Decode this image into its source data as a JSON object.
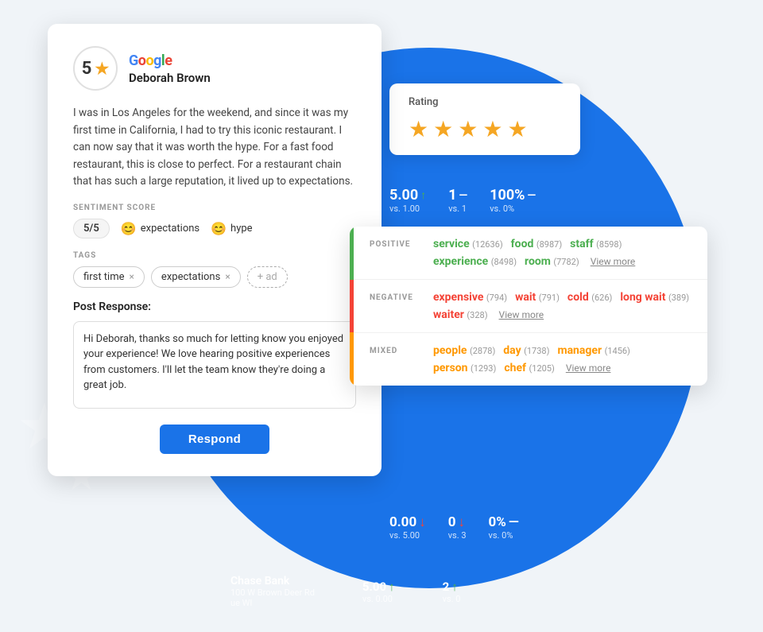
{
  "background": {
    "circle_color": "#1a73e8"
  },
  "review_card": {
    "rating": "5",
    "star_symbol": "★",
    "google_label": "Google",
    "reviewer_name": "Deborah Brown",
    "review_text": "I was in Los Angeles for the weekend, and since it was my first time in California, I had to try this iconic restaurant. I can now say that it was worth the hype. For a fast food restaurant, this is close to perfect. For a restaurant chain that has such a large reputation, it lived up to expectations.",
    "sentiment_score_label": "SENTIMENT SCORE",
    "sentiment_score": "5/5",
    "sentiment_items": [
      {
        "emoji": "😊",
        "word": "expectations"
      },
      {
        "emoji": "😊",
        "word": "hype"
      }
    ],
    "tags_label": "TAGS",
    "tags": [
      "first time",
      "expectations"
    ],
    "add_tag_label": "+ ad",
    "post_response_label": "Post Response:",
    "response_text": "Hi Deborah, thanks so much for letting know you enjoyed your experience! We love hearing positive experiences from customers. I'll let the team know they're doing a great job.",
    "respond_button": "Respond"
  },
  "rating_widget": {
    "label": "Rating",
    "stars": 5,
    "star_symbol": "★"
  },
  "stats_top": [
    {
      "value": "5.00",
      "arrow": "↑",
      "sub": "vs. 1.00"
    },
    {
      "value": "1",
      "dash": "—",
      "sub": "vs. 1"
    },
    {
      "value": "100%",
      "dash": "—",
      "sub": "vs. 0%"
    }
  ],
  "stats_bottom": [
    {
      "value": "0.00",
      "arrow": "↓",
      "sub": "vs. 5.00"
    },
    {
      "value": "0",
      "arrow": "↓",
      "sub": "vs. 3"
    },
    {
      "value": "0%",
      "dash": "—",
      "sub": "vs. 0%"
    }
  ],
  "sentiment_card": {
    "sections": [
      {
        "type": "POSITIVE",
        "words": [
          {
            "text": "service",
            "count": "12636"
          },
          {
            "text": "food",
            "count": "8987"
          },
          {
            "text": "staff",
            "count": "8598"
          },
          {
            "text": "experience",
            "count": "8498"
          },
          {
            "text": "room",
            "count": "7782"
          }
        ],
        "view_more": "View more"
      },
      {
        "type": "NEGATIVE",
        "words": [
          {
            "text": "expensive",
            "count": "794"
          },
          {
            "text": "wait",
            "count": "791"
          },
          {
            "text": "cold",
            "count": "626"
          },
          {
            "text": "long wait",
            "count": "389"
          },
          {
            "text": "waiter",
            "count": "328"
          }
        ],
        "view_more": "View more"
      },
      {
        "type": "MIXED",
        "words": [
          {
            "text": "people",
            "count": "2878"
          },
          {
            "text": "day",
            "count": "1738"
          },
          {
            "text": "manager",
            "count": "1456"
          },
          {
            "text": "person",
            "count": "1293"
          },
          {
            "text": "chef",
            "count": "1205"
          }
        ],
        "view_more": "View more"
      }
    ]
  },
  "location": {
    "name": "Chase Bank",
    "address": "100 W Brown Deer Rd",
    "city": "ue WI",
    "stat1": "5.00",
    "stat1_arrow": "↑",
    "stat1_sub": "vs. 0.00",
    "stat2": "2",
    "stat2_arrow": "↑",
    "stat2_sub": "vs. 0"
  },
  "positive_overlay": "PoSitive"
}
